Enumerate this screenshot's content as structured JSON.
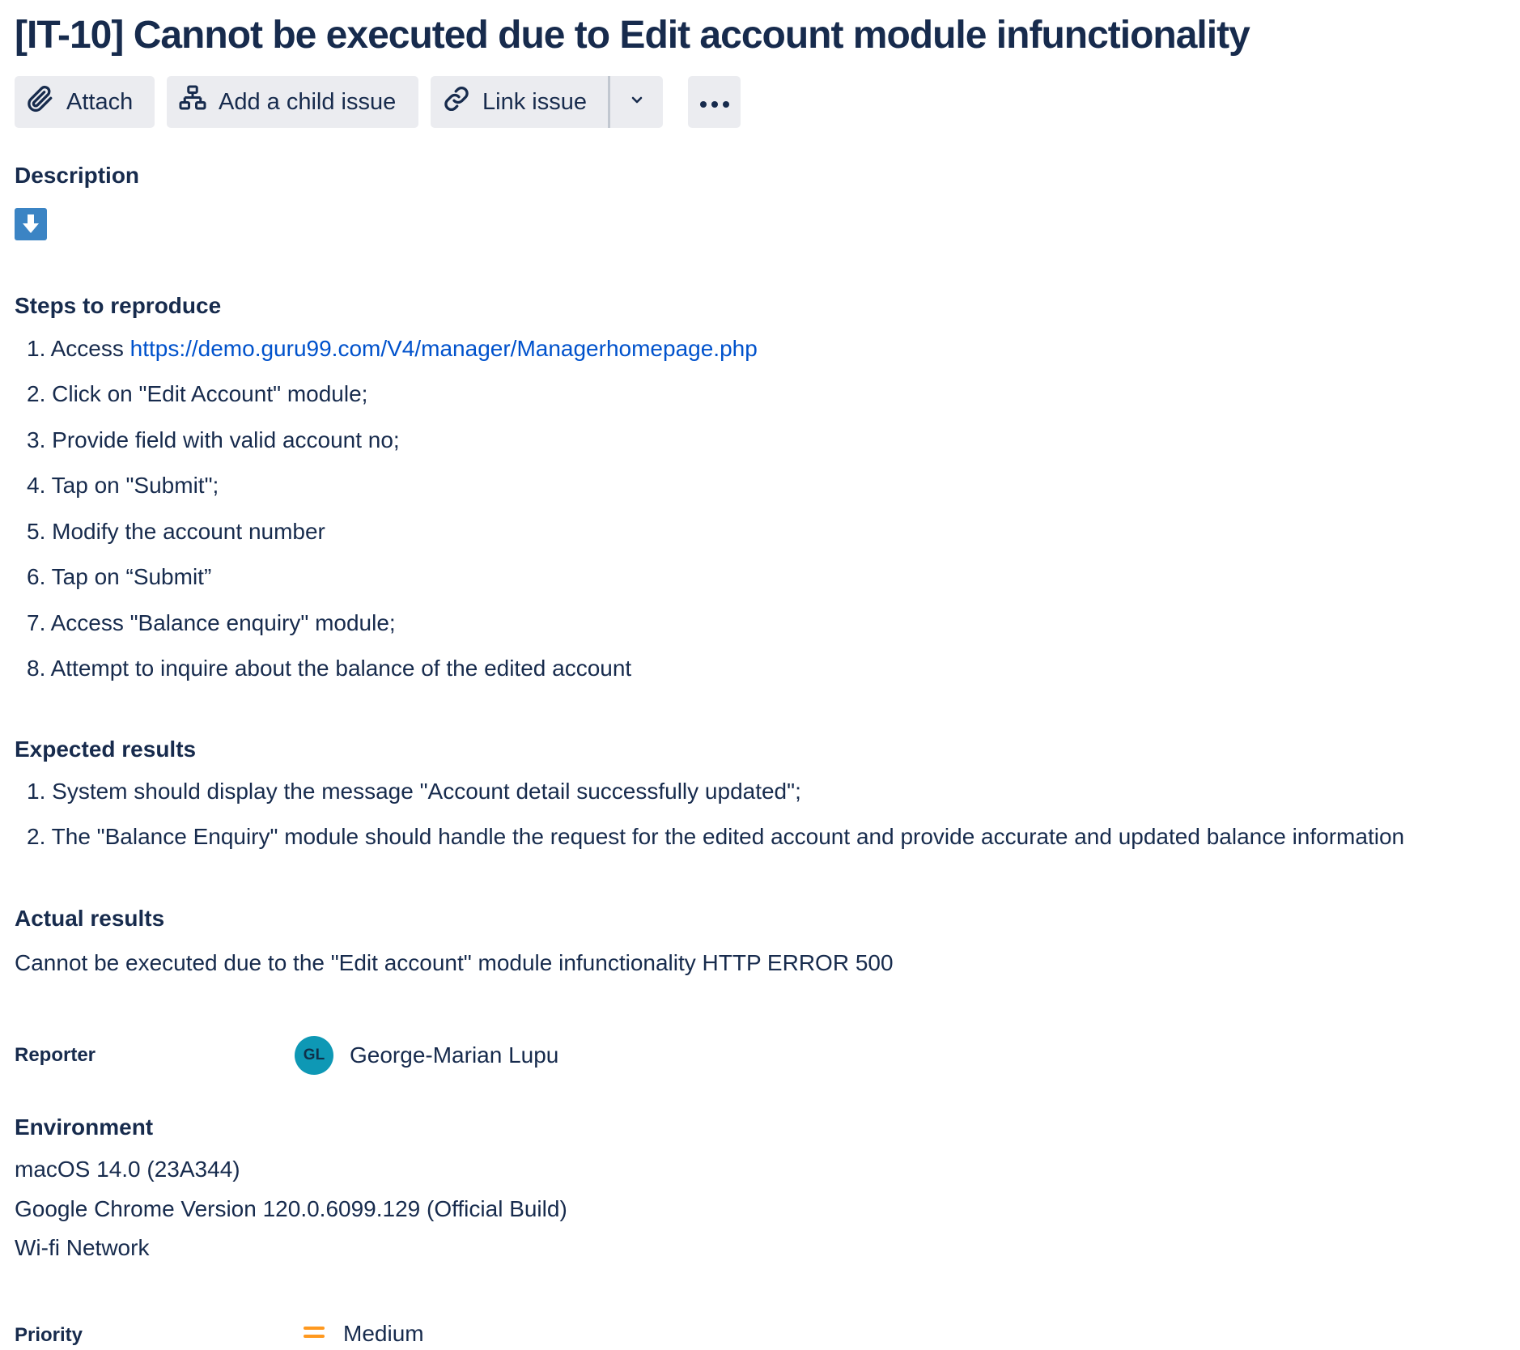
{
  "issue": {
    "title": "[IT-10] Cannot be executed due to Edit account module infunctionality"
  },
  "toolbar": {
    "attach_label": "Attach",
    "add_child_label": "Add a child issue",
    "link_issue_label": "Link issue",
    "icons": [
      "paperclip-icon",
      "child-issue-icon",
      "link-icon",
      "chevron-down-icon",
      "more-icon"
    ]
  },
  "description": {
    "heading": "Description",
    "steps_heading": "Steps to reproduce",
    "steps": [
      {
        "num": "1.",
        "prefix": "Access ",
        "link": "https://demo.guru99.com/V4/manager/Managerhomepage.php"
      },
      {
        "num": "2.",
        "text": "Click on \"Edit Account\" module;"
      },
      {
        "num": "3.",
        "text": "Provide field with valid account no;"
      },
      {
        "num": "4.",
        "text": "Tap on \"Submit\";"
      },
      {
        "num": "5.",
        "text": "Modify the account number"
      },
      {
        "num": "6.",
        "text": "Tap on “Submit”"
      },
      {
        "num": "7.",
        "text": "Access \"Balance enquiry\" module;"
      },
      {
        "num": "8.",
        "text": "Attempt to inquire about the balance of the edited account"
      }
    ],
    "expected_heading": "Expected results",
    "expected": [
      {
        "num": "1.",
        "text": "System should display the message \"Account detail successfully updated\";"
      },
      {
        "num": "2.",
        "text": "The \"Balance Enquiry\" module should handle the request for the edited account and provide accurate and updated balance information"
      }
    ],
    "actual_heading": "Actual results",
    "actual_text": "Cannot be executed due to the \"Edit account\" module infunctionality HTTP ERROR 500"
  },
  "reporter": {
    "label": "Reporter",
    "initials": "GL",
    "name": "George-Marian Lupu",
    "avatar_color": "#0e98b5"
  },
  "environment": {
    "heading": "Environment",
    "lines": [
      "macOS 14.0 (23A344)",
      "Google Chrome Version 120.0.6099.129 (Official Build)",
      "Wi-fi Network"
    ]
  },
  "priority": {
    "label": "Priority",
    "value": "Medium",
    "icon": "priority-medium-icon",
    "color": "#ff991f"
  },
  "colors": {
    "text": "#172b4d",
    "link": "#0052cc",
    "button_bg": "#ebecf0"
  }
}
